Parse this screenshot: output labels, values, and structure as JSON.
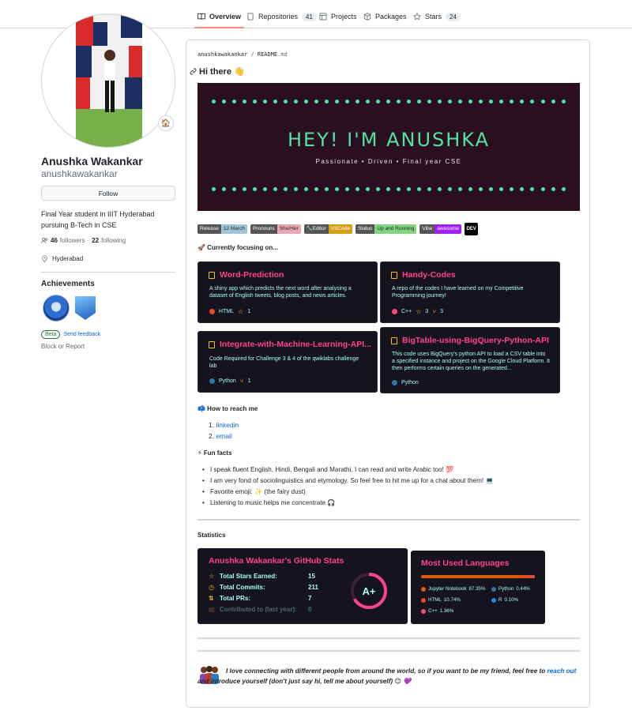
{
  "tabs": [
    {
      "label": "Overview",
      "count": null,
      "icon": "book-icon"
    },
    {
      "label": "Repositories",
      "count": "41",
      "icon": "repo-icon"
    },
    {
      "label": "Projects",
      "count": null,
      "icon": "table-icon"
    },
    {
      "label": "Packages",
      "count": null,
      "icon": "package-icon"
    },
    {
      "label": "Stars",
      "count": "24",
      "icon": "star-icon"
    }
  ],
  "profile": {
    "full_name": "Anushka Wakankar",
    "username": "anushkawakankar",
    "follow_label": "Follow",
    "bio": "Final Year student in IIIT Hyderabad pursuing B-Tech in CSE",
    "followers_count": "46",
    "followers_label": "followers",
    "following_count": "22",
    "following_label": "following",
    "location": "Hyderabad",
    "status_emoji": "🏠"
  },
  "achievements": {
    "title": "Achievements",
    "beta_label": "Beta",
    "feedback_label": "Send feedback",
    "block_label": "Block or Report"
  },
  "readme": {
    "owner": "anushkawakankar",
    "file": "README",
    "ext": ".md",
    "greeting": "Hi there 👋",
    "banner_title": "HEY! I'M ANUSHKA",
    "banner_subtitle": "Passionate • Driven • Final year CSE",
    "shields": [
      {
        "left": "Release",
        "right": "12 March",
        "color": "#9fc6d6"
      },
      {
        "left": "Pronouns",
        "right": "She/Her",
        "color": "#e9a7b3"
      },
      {
        "left": "🔧Editor",
        "right": "VSCode",
        "color": "#d4a017"
      },
      {
        "left": "Status",
        "right": "Up and Running",
        "color": "#7fd67f"
      },
      {
        "left": "Vibe",
        "right": "awesome",
        "color": "#a020f0"
      }
    ],
    "dev_badge": "DEV",
    "focus_heading": "🚀 Currently focusing on...",
    "cards": [
      {
        "title": "Word-Prediction",
        "desc": "A shiny app which predicts the next word after analysing a dataset of English tweets, blog posts, and news articles.",
        "lang": "HTML",
        "lang_color": "#e34c26",
        "stars": "1",
        "forks": ""
      },
      {
        "title": "Handy-Codes",
        "desc": "A repo of the codes I have learned on my Competitive Programming journey!",
        "lang": "C++",
        "lang_color": "#f34b7d",
        "stars": "3",
        "forks": "3"
      },
      {
        "title": "Integrate-with-Machine-Learning-API...",
        "desc": "Code Required for Challenge 3 & 4 of the qwiklabs challenge lab",
        "lang": "Python",
        "lang_color": "#3572A5",
        "stars": "",
        "forks": "1"
      },
      {
        "title": "BigTable-using-BigQuery-Python-API",
        "desc": "This code uses BigQuery's python API to load a CSV table into a specified instance and project on the Google Cloud Platform. It then performs certain queries on the generated...",
        "lang": "Python",
        "lang_color": "#3572A5",
        "stars": "",
        "forks": ""
      }
    ],
    "reach_heading": "📫 How to reach me",
    "reach_links": [
      "linkedin",
      "email"
    ],
    "facts_heading": "⚡ Fun facts",
    "facts": [
      "I speak fluent English, Hindi, Bengali and Marathi. I can read and write Arabic too! 💯",
      "I am very fond of sociolinguistics and etymology. So feel free to hit me up for a chat about them! 💻",
      "Favorite emoji: ✨ (the fairy dust)",
      "Listening to music helps me concentrate 🎧"
    ],
    "stats_heading": "Statistics",
    "stats": {
      "title": "Anushka Wakankar's GitHub Stats",
      "rows": [
        {
          "label": "Total Stars Earned:",
          "value": "15",
          "icon": "star-icon"
        },
        {
          "label": "Total Commits:",
          "value": "211",
          "icon": "clock-icon"
        },
        {
          "label": "Total PRs:",
          "value": "7",
          "icon": "pr-icon"
        },
        {
          "label": "Contributed to (last year):",
          "value": "0",
          "icon": "repo-icon"
        }
      ],
      "grade": "A+"
    },
    "languages": {
      "title": "Most Used Languages",
      "items": [
        {
          "name": "Jupyter Notebook",
          "pct": "87.35%",
          "color": "#DA5B0B"
        },
        {
          "name": "Python",
          "pct": "0.44%",
          "color": "#3572A5"
        },
        {
          "name": "HTML",
          "pct": "10.74%",
          "color": "#e34c26"
        },
        {
          "name": "R",
          "pct": "0.10%",
          "color": "#198CE7"
        },
        {
          "name": "C++",
          "pct": "1.36%",
          "color": "#f34b7d"
        }
      ]
    },
    "closing_text_1": "I love connecting with different people from around the world, so if you want to be my friend, feel free to ",
    "closing_link": "reach out",
    "closing_text_2": "and introduce yourself (don't just say hi, tell me about yourself) 😊 💜"
  }
}
